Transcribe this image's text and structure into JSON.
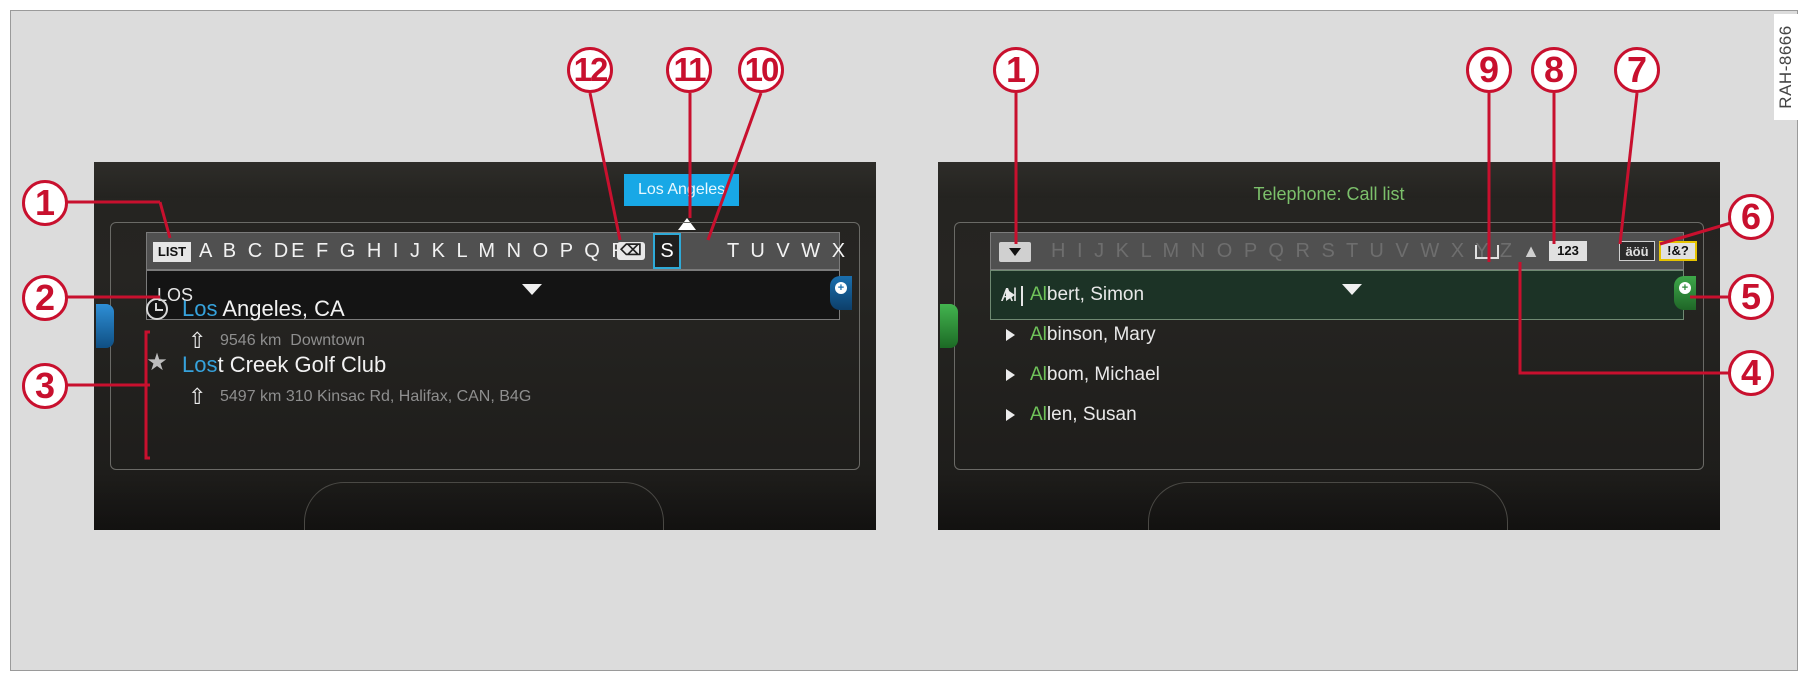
{
  "watermark": "RAH-8666",
  "colors": {
    "callout_red": "#c8102e",
    "screen_bg": "#242320",
    "nav_accent_blue": "#36a2dc",
    "phone_accent_green": "#6fc35a"
  },
  "left_screen": {
    "list_key_label": "LIST",
    "alphabet_row_a": "A B C DE F G H I J K L M N O P Q R",
    "selected_letter": "S",
    "alphabet_row_b": "T U V W X",
    "delete_key_label": "⌫",
    "selection_bubble": "Los Angeles",
    "input_value": "LOS",
    "results": [
      {
        "match": "Los",
        "rest": " Angeles, CA",
        "icon": "recent-clock-icon",
        "distance": "9546 km",
        "detail": "Downtown"
      },
      {
        "match": "Los",
        "rest": "t Creek Golf Club",
        "icon": "favorite-star-icon",
        "distance": "5497 km",
        "detail": "310 Kinsac Rd, Halifax, CAN, B4G"
      }
    ]
  },
  "right_screen": {
    "title": "Telephone: Call list",
    "alphabet_row": "H I J K L M N O P Q R S T U V W X Y Z",
    "icons": {
      "space": "space-key-icon",
      "shift": "shift-key-icon",
      "numbers": "123",
      "umlaut": "äöü",
      "special": "!&?"
    },
    "input_value": "Al",
    "contacts": [
      {
        "match": "Al",
        "rest": "bert, Simon"
      },
      {
        "match": "Al",
        "rest": "binson, Mary"
      },
      {
        "match": "Al",
        "rest": "bom, Michael"
      },
      {
        "match": "Al",
        "rest": "len, Susan"
      }
    ]
  },
  "callouts_left": [
    "1",
    "2",
    "3",
    "12",
    "11",
    "10"
  ],
  "callouts_right": [
    "1",
    "9",
    "8",
    "7",
    "6",
    "5",
    "4"
  ]
}
